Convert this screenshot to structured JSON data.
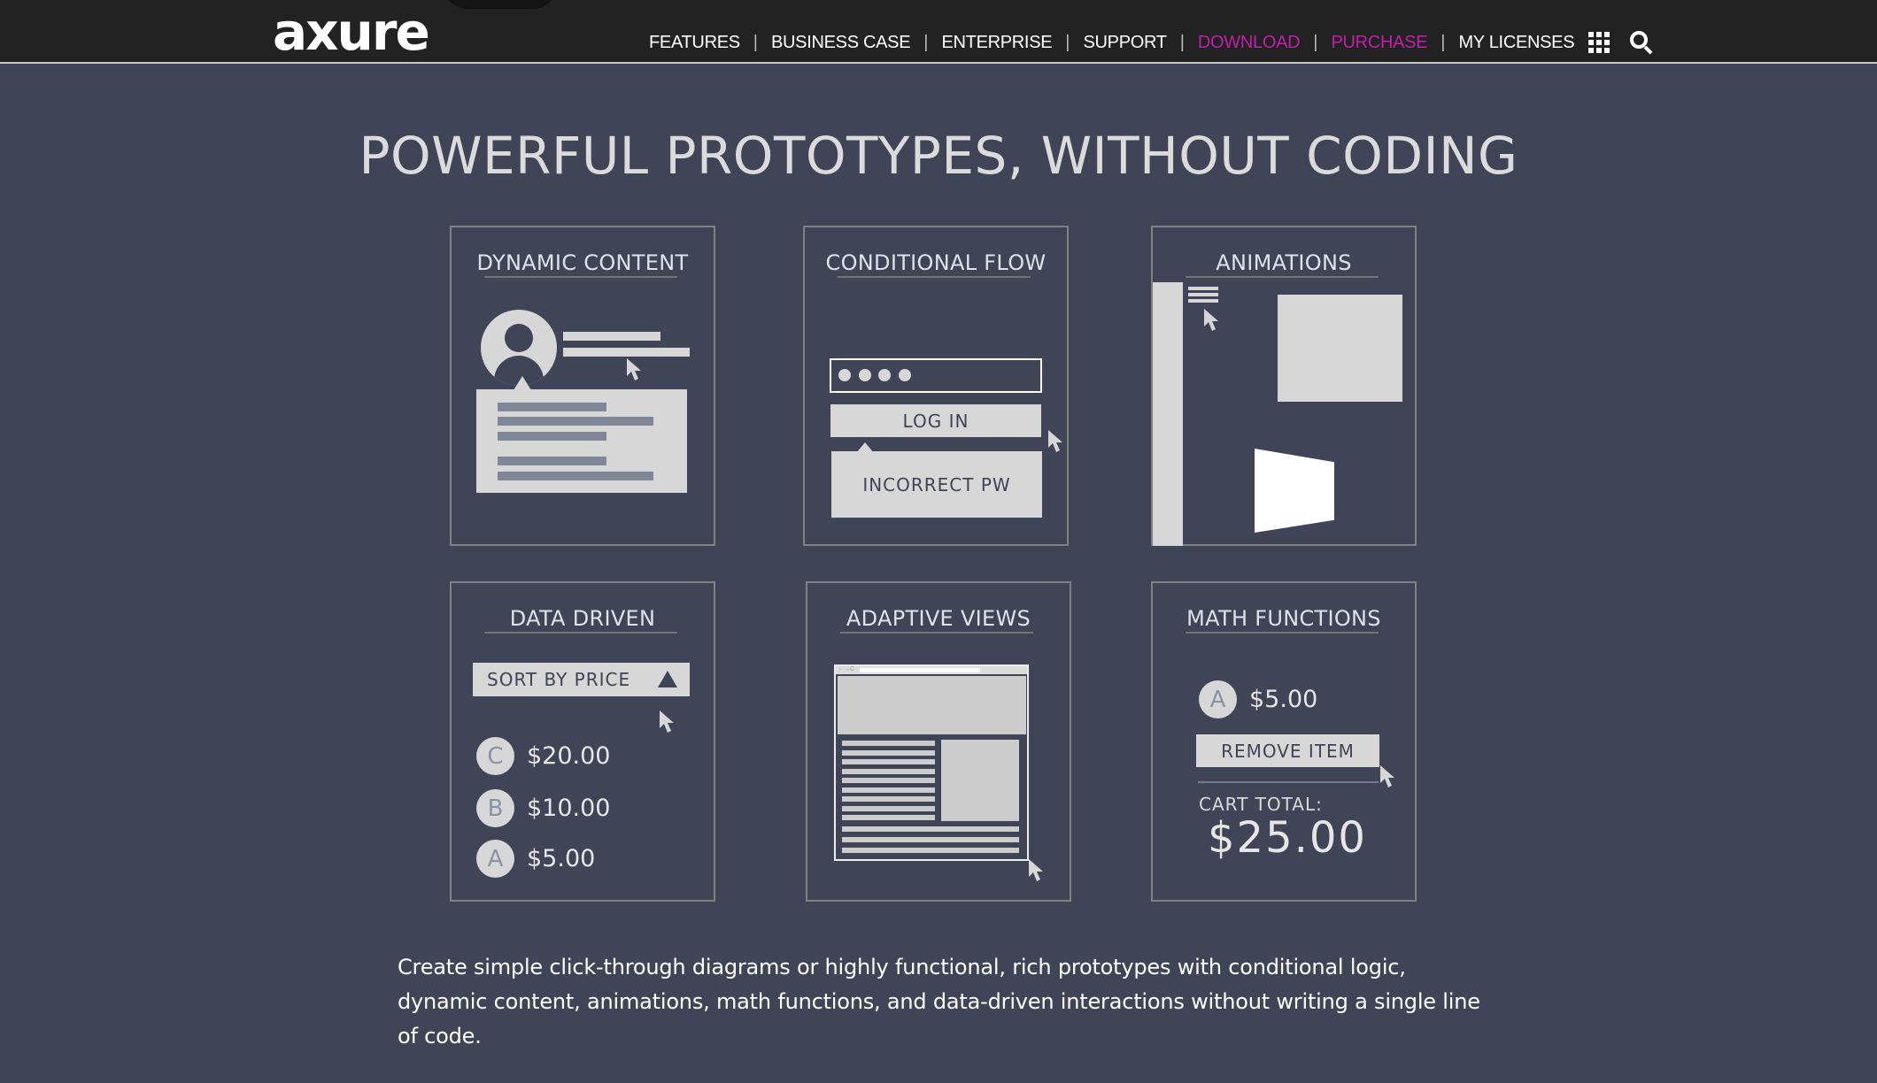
{
  "header": {
    "logo_text": "axure",
    "nav": [
      {
        "label": "FEATURES",
        "accent": false
      },
      {
        "label": "BUSINESS CASE",
        "accent": false
      },
      {
        "label": "ENTERPRISE",
        "accent": false
      },
      {
        "label": "SUPPORT",
        "accent": false
      },
      {
        "label": "DOWNLOAD",
        "accent": true
      },
      {
        "label": "PURCHASE",
        "accent": true
      },
      {
        "label": "MY LICENSES",
        "accent": false
      }
    ],
    "separator": "|",
    "icons": [
      "apps-grid-icon",
      "search-icon"
    ],
    "accent_color": "#c21ea8"
  },
  "main": {
    "headline": "POWERFUL PROTOTYPES, WITHOUT CODING",
    "cards": [
      {
        "title": "DYNAMIC CONTENT"
      },
      {
        "title": "CONDITIONAL FLOW",
        "password_mask": "●●●●",
        "login_label": "LOG IN",
        "error_label": "INCORRECT PW"
      },
      {
        "title": "ANIMATIONS"
      },
      {
        "title": "DATA DRIVEN",
        "sort_label": "SORT BY PRICE",
        "items": [
          {
            "badge": "C",
            "price": "$20.00"
          },
          {
            "badge": "B",
            "price": "$10.00"
          },
          {
            "badge": "A",
            "price": "$5.00"
          }
        ]
      },
      {
        "title": "ADAPTIVE VIEWS",
        "browser_nav_glyph": "←→C"
      },
      {
        "title": "MATH FUNCTIONS",
        "item_badge": "A",
        "item_price": "$5.00",
        "remove_label": "REMOVE ITEM",
        "cart_total_label": "CART TOTAL:",
        "cart_total_value": "$25.00"
      }
    ],
    "description": "Create simple click-through diagrams or highly functional, rich prototypes with conditional logic, dynamic content, animations, math functions, and data-driven interactions without writing a single line of code."
  },
  "colors": {
    "page_bg": "#3f4556",
    "nav_bg": "#222222",
    "illustration_fill": "#d7d7d7",
    "card_border": "#7f8182"
  }
}
